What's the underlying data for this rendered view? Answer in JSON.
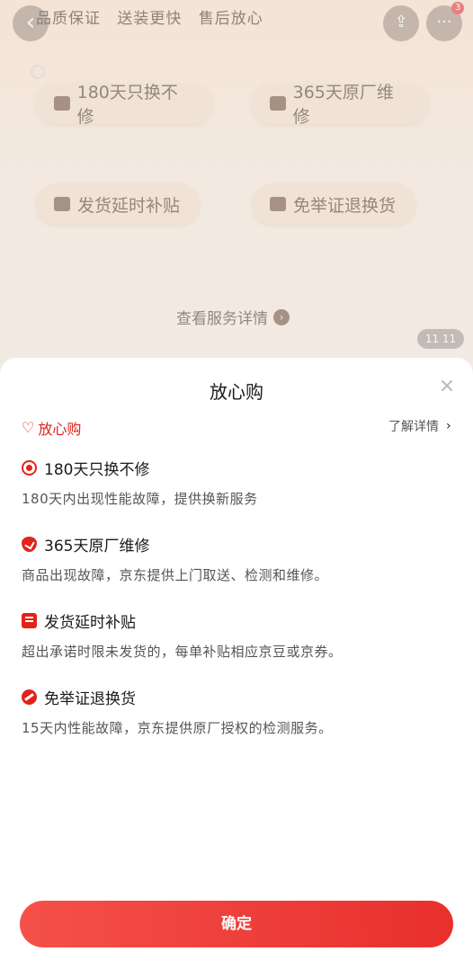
{
  "background": {
    "slogan": [
      "品质保证",
      "送装更快",
      "售后放心"
    ],
    "more_badge": "3",
    "services": [
      "180天只换不修",
      "365天原厂维修",
      "发货延时补贴",
      "免举证退换货"
    ],
    "view_detail": "查看服务详情",
    "counter": "11 11"
  },
  "sheet": {
    "title": "放心购",
    "brand": "放心购",
    "more_link": "了解详情",
    "items": [
      {
        "title": "180天只换不修",
        "desc": "180天内出现性能故障，提供换新服务",
        "icon": "exchange-icon"
      },
      {
        "title": "365天原厂维修",
        "desc": "商品出现故障，京东提供上门取送、检测和维修。",
        "icon": "shield-icon"
      },
      {
        "title": "发货延时补贴",
        "desc": "超出承诺时限未发货的，每单补贴相应京豆或京券。",
        "icon": "ticket-icon"
      },
      {
        "title": "免举证退换货",
        "desc": "15天内性能故障，京东提供原厂授权的检测服务。",
        "icon": "no-proof-icon"
      }
    ],
    "confirm": "确定"
  },
  "colors": {
    "accent": "#e2231a",
    "button_gradient_start": "#f5504a",
    "button_gradient_end": "#e8302c"
  }
}
